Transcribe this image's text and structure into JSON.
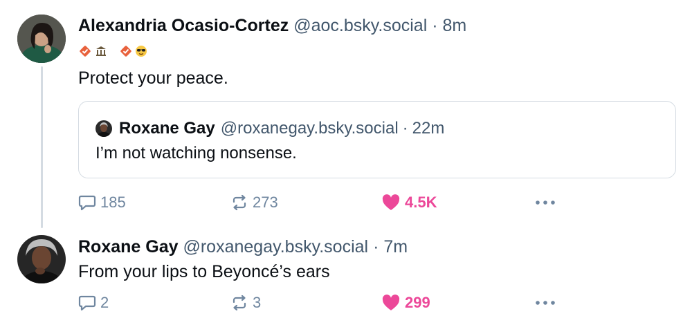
{
  "posts": [
    {
      "author": "Alexandria Ocasio-Cortez",
      "handle": "@aoc.bsky.social",
      "sep": "·",
      "time": "8m",
      "badges": [
        "verified-check-icon",
        "bank-icon",
        "verified-check-icon",
        "sunglasses-emoji"
      ],
      "text": "Protect your peace.",
      "quote": {
        "author": "Roxane Gay",
        "handle": "@roxanegay.bsky.social",
        "sep": "·",
        "time": "22m",
        "text": "I’m not watching nonsense."
      },
      "replies": "185",
      "reposts": "273",
      "likes": "4.5K"
    },
    {
      "author": "Roxane Gay",
      "handle": "@roxanegay.bsky.social",
      "sep": "·",
      "time": "7m",
      "text": "From your lips to Beyoncé’s ears",
      "replies": "2",
      "reposts": "3",
      "likes": "299"
    }
  ],
  "colors": {
    "like": "#ec4899",
    "meta": "#6f869f",
    "handle": "#42576c",
    "border": "#d4dbe2"
  }
}
